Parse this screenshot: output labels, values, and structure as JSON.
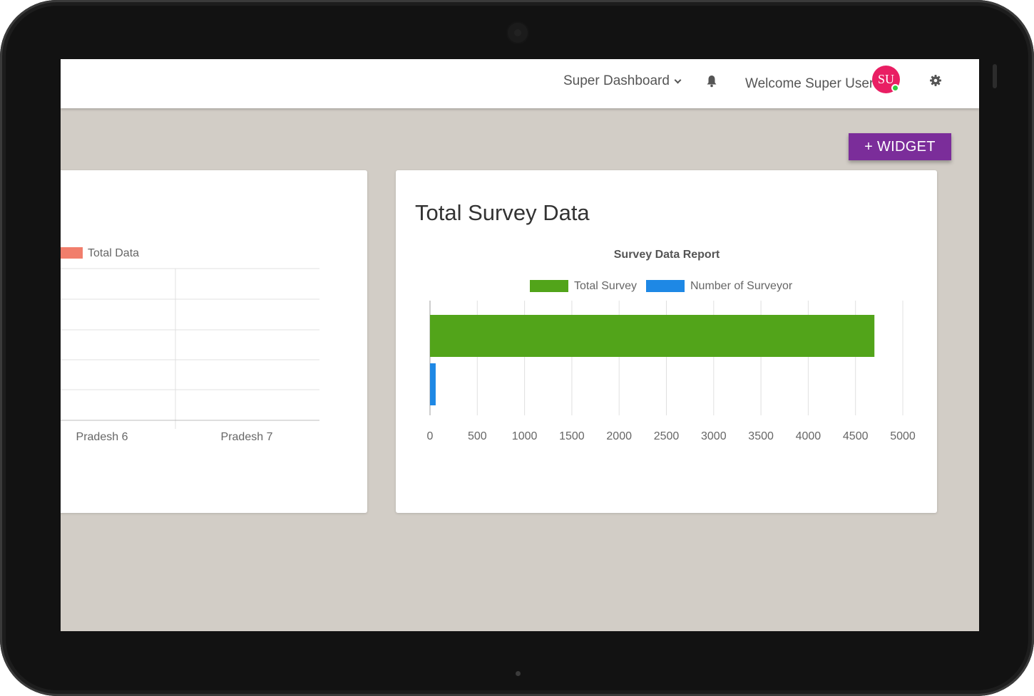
{
  "header": {
    "dashboard_label": "Super Dashboard",
    "welcome_text": "Welcome Super User",
    "avatar_initials": "SU",
    "icons": [
      "bell-icon",
      "gear-icon",
      "chevron-down-icon"
    ]
  },
  "actions": {
    "widget_button": "+ WIDGET"
  },
  "colors": {
    "accent": "#7b2d9a",
    "avatar": "#e91e63",
    "total_survey": "#52a41a",
    "surveyor": "#1e88e5",
    "total_data": "#f17e6c"
  },
  "left_card": {
    "legend_label": "Total Data"
  },
  "right_card": {
    "title": "Total Survey Data"
  },
  "chart_data": [
    {
      "type": "bar",
      "categories": [
        "Pradesh 6",
        "Pradesh 7"
      ],
      "series": [
        {
          "name": "Total Data",
          "values": []
        }
      ],
      "title": "",
      "grid": true,
      "legend": "top"
    },
    {
      "type": "bar",
      "orientation": "horizontal",
      "title": "Survey Data Report",
      "series": [
        {
          "name": "Total Survey",
          "values": [
            4700
          ]
        },
        {
          "name": "Number of Surveyor",
          "values": [
            60
          ]
        }
      ],
      "xticks": [
        "0",
        "500",
        "1000",
        "1500",
        "2000",
        "2500",
        "3000",
        "3500",
        "4000",
        "4500",
        "5000"
      ],
      "xlim": [
        0,
        5000
      ],
      "grid": true,
      "legend": "top"
    }
  ]
}
